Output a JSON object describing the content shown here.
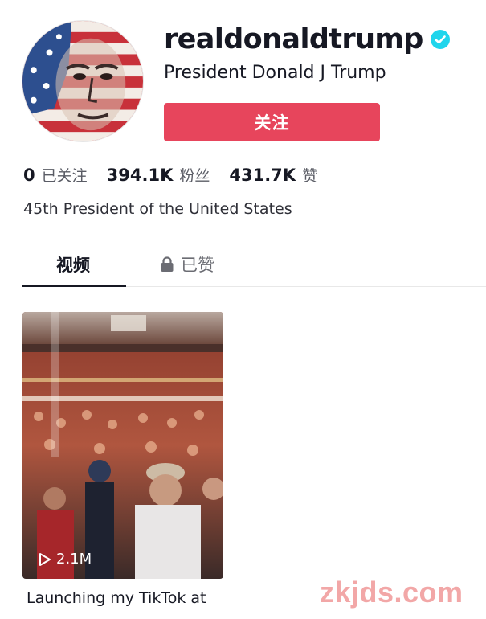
{
  "profile": {
    "username": "realdonaldtrump",
    "nickname": "President Donald J Trump",
    "follow_label": "关注",
    "bio": "45th President of the United States",
    "verified": true
  },
  "stats": [
    {
      "value": "0",
      "label": "已关注"
    },
    {
      "value": "394.1K",
      "label": "粉丝"
    },
    {
      "value": "431.7K",
      "label": "赞"
    }
  ],
  "tabs": [
    {
      "label": "视频",
      "active": true
    },
    {
      "label": "已赞",
      "locked": true
    }
  ],
  "videos": [
    {
      "views": "2.1M",
      "caption": "Launching my TikTok at"
    }
  ],
  "watermark": "zkjds.com",
  "colors": {
    "follow_button": "#e7455c",
    "verified_badge": "#20d5ec",
    "text_primary": "#161823"
  },
  "icons": {
    "verified": "verified-badge-icon",
    "lock": "lock-icon",
    "play": "play-icon"
  }
}
